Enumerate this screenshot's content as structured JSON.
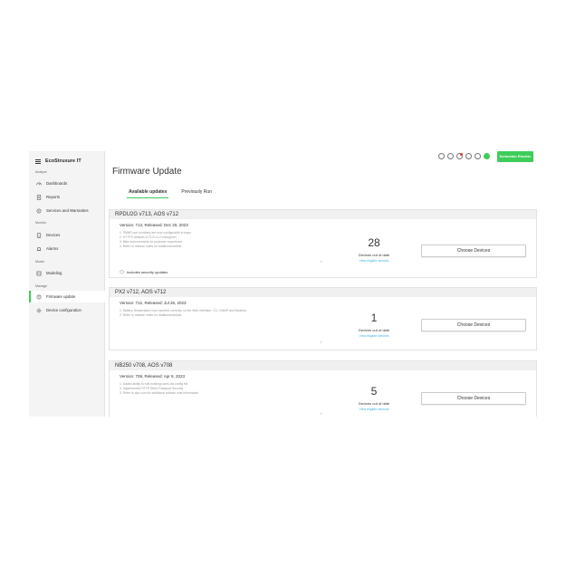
{
  "brand": {
    "name": "EcoStruxure IT"
  },
  "sidebar": {
    "sections": [
      {
        "label": "Analyze",
        "items": [
          {
            "label": "Dashboards",
            "icon": "gauge-icon"
          },
          {
            "label": "Reports",
            "icon": "report-icon"
          },
          {
            "label": "Services and Warranties",
            "icon": "services-icon"
          }
        ]
      },
      {
        "label": "Monitor",
        "items": [
          {
            "label": "Devices",
            "icon": "device-icon"
          },
          {
            "label": "Alarms",
            "icon": "alarm-icon"
          }
        ]
      },
      {
        "label": "Model",
        "items": [
          {
            "label": "Modeling",
            "icon": "modeling-icon"
          }
        ]
      },
      {
        "label": "Manage",
        "items": [
          {
            "label": "Firmware update",
            "icon": "firmware-icon",
            "active": true
          },
          {
            "label": "Device configuration",
            "icon": "config-icon"
          }
        ]
      }
    ]
  },
  "topbar": {
    "icons": [
      "refresh-icon",
      "help-icon",
      "notification-icon",
      "settings-icon",
      "globe-icon",
      "status-icon"
    ],
    "logo": "Schneider Electric"
  },
  "page": {
    "title": "Firmware Update",
    "tabs": [
      "Available updates",
      "Previously Run"
    ]
  },
  "cards": [
    {
      "title": "RPDU2G v713, AOS v712",
      "version": "Version: 713, Released: Dec 20, 2023",
      "notes": [
        "1. SNMP port numbers are now configurable in traps",
        "2. HTTPS defaults to TLS v1.2 encryption",
        "3. Misc improvements to customer experience",
        "4. Refer to release notes for additional details"
      ],
      "count": "28",
      "count_caption": "Devices out of date",
      "link": "View eligible devices",
      "button": "Choose Devices",
      "security": "Includes security updates"
    },
    {
      "title": "PX2 v712, AOS v712",
      "version": "Version: 712, Released: Jul 26, 2023",
      "notes": [
        "1. Battery Temperature now reported correctly on the Web Interface, CLI, SNMP and Modbus",
        "2. Refer to release notes for additional details"
      ],
      "count": "1",
      "count_caption": "Devices out of date",
      "link": "View eligible devices",
      "button": "Choose Devices"
    },
    {
      "title": "NB250 v708, AOS v708",
      "version": "Version: 708, Released: Apr 9, 2023",
      "notes": [
        "1. Added ability to edit existing users via config file",
        "2. Implemented HTTP Strict Transport Security",
        "3. Refer to apc.com for additional release note information"
      ],
      "count": "5",
      "count_caption": "Devices out of date",
      "link": "View eligible devices",
      "button": "Choose Devices"
    }
  ]
}
